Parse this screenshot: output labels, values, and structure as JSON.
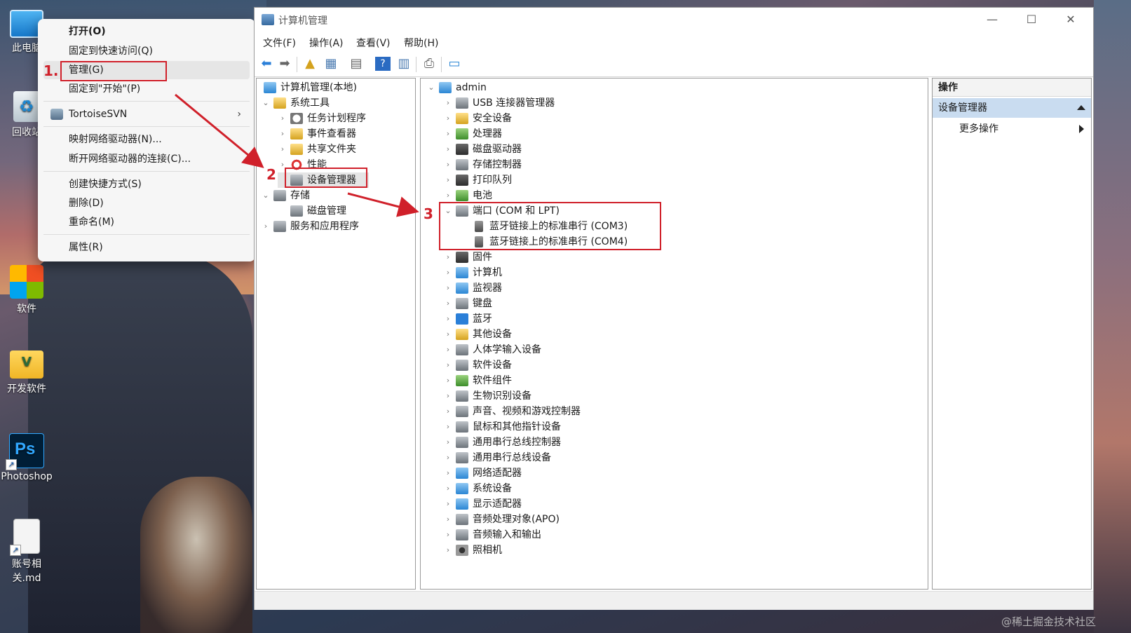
{
  "desktop": {
    "icons": [
      {
        "label": "此电脑"
      },
      {
        "label": "回收站"
      },
      {
        "label": "软件"
      },
      {
        "label": "开发软件"
      },
      {
        "label": "Photoshop"
      },
      {
        "label": "账号相关.md"
      }
    ],
    "ps_glyph": "Ps"
  },
  "context_menu": {
    "items": [
      "打开(O)",
      "固定到快速访问(Q)",
      "管理(G)",
      "固定到\"开始\"(P)",
      "TortoiseSVN",
      "映射网络驱动器(N)...",
      "断开网络驱动器的连接(C)...",
      "创建快捷方式(S)",
      "删除(D)",
      "重命名(M)",
      "属性(R)"
    ],
    "submenu_arrow": "›"
  },
  "annotations": {
    "step1": "1.",
    "step2": "2",
    "step3": "3",
    "color": "#d0202a"
  },
  "window": {
    "title": "计算机管理",
    "controls": {
      "minimize": "—",
      "maximize": "☐",
      "close": "✕"
    },
    "menu": [
      "文件(F)",
      "操作(A)",
      "查看(V)",
      "帮助(H)"
    ],
    "toolbar_icons": [
      "back-icon",
      "forward-icon",
      "up-folder-icon",
      "console-tree-icon",
      "properties-icon",
      "help-icon",
      "view-icon",
      "scan-hardware-icon",
      "monitor-icon"
    ]
  },
  "tree": {
    "root": "计算机管理(本地)",
    "system_tools": "系统工具",
    "task_scheduler": "任务计划程序",
    "event_viewer": "事件查看器",
    "shared_folders": "共享文件夹",
    "performance": "性能",
    "device_manager": "设备管理器",
    "storage": "存储",
    "disk_management": "磁盘管理",
    "services_apps": "服务和应用程序"
  },
  "devices": {
    "root": "admin",
    "categories": [
      "USB 连接器管理器",
      "安全设备",
      "处理器",
      "磁盘驱动器",
      "存储控制器",
      "打印队列",
      "电池",
      "端口 (COM 和 LPT)",
      "固件",
      "计算机",
      "监视器",
      "键盘",
      "蓝牙",
      "其他设备",
      "人体学输入设备",
      "软件设备",
      "软件组件",
      "生物识别设备",
      "声音、视频和游戏控制器",
      "鼠标和其他指针设备",
      "通用串行总线控制器",
      "通用串行总线设备",
      "网络适配器",
      "系统设备",
      "显示适配器",
      "音频处理对象(APO)",
      "音频输入和输出",
      "照相机"
    ],
    "ports": [
      "蓝牙链接上的标准串行 (COM3)",
      "蓝牙链接上的标准串行 (COM4)"
    ]
  },
  "actions": {
    "header": "操作",
    "selected": "设备管理器",
    "more": "更多操作"
  },
  "watermark": "@稀土掘金技术社区",
  "glyphs": {
    "collapsed": "›",
    "expanded": "⌄"
  }
}
